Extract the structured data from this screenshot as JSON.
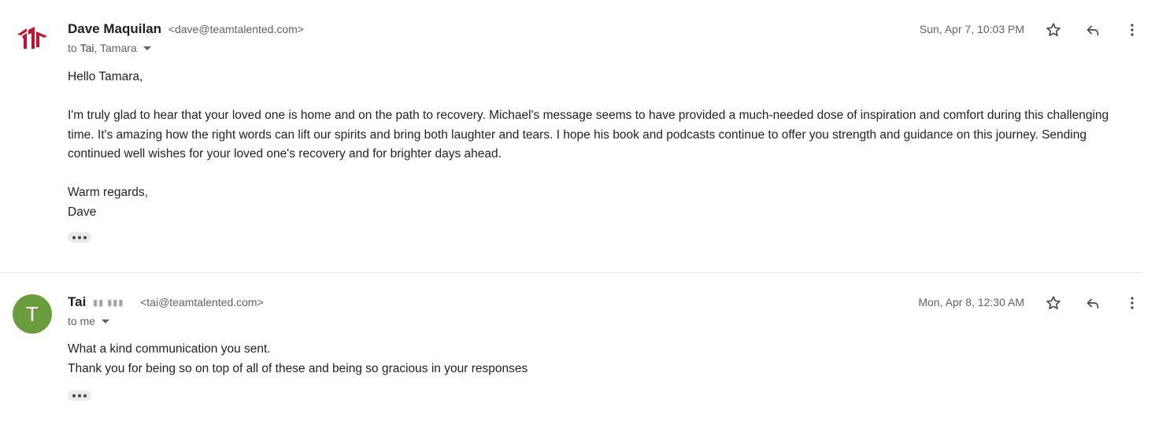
{
  "messages": [
    {
      "sender_name": "Dave Maquilan",
      "sender_email": "<dave@teamtalented.com>",
      "to_prefix": "to",
      "to_first": "Tai",
      "to_rest": ", Tamara",
      "date": "Sun, Apr 7, 10:03 PM",
      "avatar_icon": "company-logo-icon",
      "body": {
        "greeting": "Hello Tamara,",
        "paragraph": "I'm truly glad to hear that your loved one is home and on the path to recovery. Michael's message seems to have provided a much-needed dose of inspiration and comfort during this challenging time. It's amazing how the right words can lift our spirits and bring both laughter and tears. I hope his book and podcasts continue to offer you strength and guidance on this journey. Sending continued well wishes for your loved one's recovery and for brighter days ahead.",
        "closing": "Warm regards,",
        "signature": "Dave"
      }
    },
    {
      "sender_name": "Tai",
      "sender_email": "<tai@teamtalented.com>",
      "to_prefix": "to",
      "to_first": "me",
      "to_rest": "",
      "date": "Mon, Apr 8, 12:30 AM",
      "avatar_letter": "T",
      "avatar_color": "#6a9e3c",
      "body": {
        "line1": "What a kind communication you sent.",
        "line2": "Thank you for being so on top of all of these and being so gracious in your responses"
      }
    }
  ],
  "icons": {
    "star": "star-icon",
    "reply": "reply-icon",
    "more": "more-vert-icon",
    "expand": "show-trimmed-content-icon"
  },
  "colors": {
    "logo_red": "#c8102e",
    "avatar_green": "#6a9e3c",
    "secondary_text": "#5f6368"
  }
}
